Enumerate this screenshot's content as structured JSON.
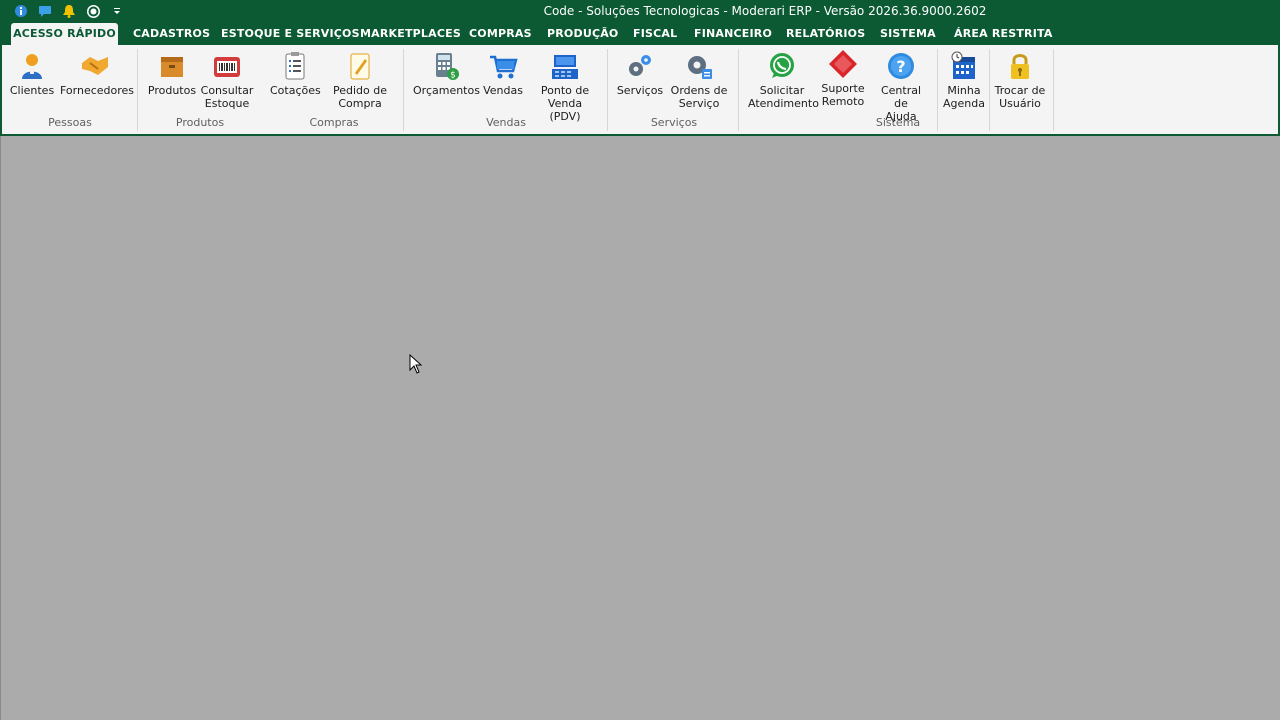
{
  "window": {
    "title": "Code - Soluções Tecnologicas - Moderari ERP - Versão 2026.36.9000.2602",
    "quick_access": [
      "info-icon",
      "chat-icon",
      "bell-icon",
      "whatsapp-icon",
      "dropdown-icon"
    ]
  },
  "tabs": [
    {
      "label": "ACESSO RÁPIDO"
    },
    {
      "label": "CADASTROS"
    },
    {
      "label": "ESTOQUE E SERVIÇOS"
    },
    {
      "label": "MARKETPLACES"
    },
    {
      "label": "COMPRAS"
    },
    {
      "label": "PRODUÇÃO"
    },
    {
      "label": "FISCAL"
    },
    {
      "label": "FINANCEIRO"
    },
    {
      "label": "RELATÓRIOS"
    },
    {
      "label": "SISTEMA"
    },
    {
      "label": "ÁREA RESTRITA"
    }
  ],
  "ribbon": {
    "groups": [
      {
        "label": "Pessoas"
      },
      {
        "label": "Produtos"
      },
      {
        "label": "Compras"
      },
      {
        "label": "Vendas"
      },
      {
        "label": "Serviços"
      },
      {
        "label": "Sistema"
      }
    ],
    "buttons": [
      {
        "label": "Clientes"
      },
      {
        "label": "Fornecedores"
      },
      {
        "label": "Produtos"
      },
      {
        "label": "Consultar\nEstoque"
      },
      {
        "label": "Cotações"
      },
      {
        "label": "Pedido de\nCompra"
      },
      {
        "label": "Orçamentos"
      },
      {
        "label": "Vendas"
      },
      {
        "label": "Ponto de\nVenda (PDV)"
      },
      {
        "label": "Serviços"
      },
      {
        "label": "Ordens de\nServiço"
      },
      {
        "label": "Solicitar\nAtendimento"
      },
      {
        "label": "Suporte\nRemoto"
      },
      {
        "label": "Central de\nAjuda"
      },
      {
        "label": "Minha\nAgenda"
      },
      {
        "label": "Trocar de\nUsuário"
      }
    ]
  },
  "colors": {
    "brand_green": "#0b5a33",
    "workspace": "#ababab"
  }
}
